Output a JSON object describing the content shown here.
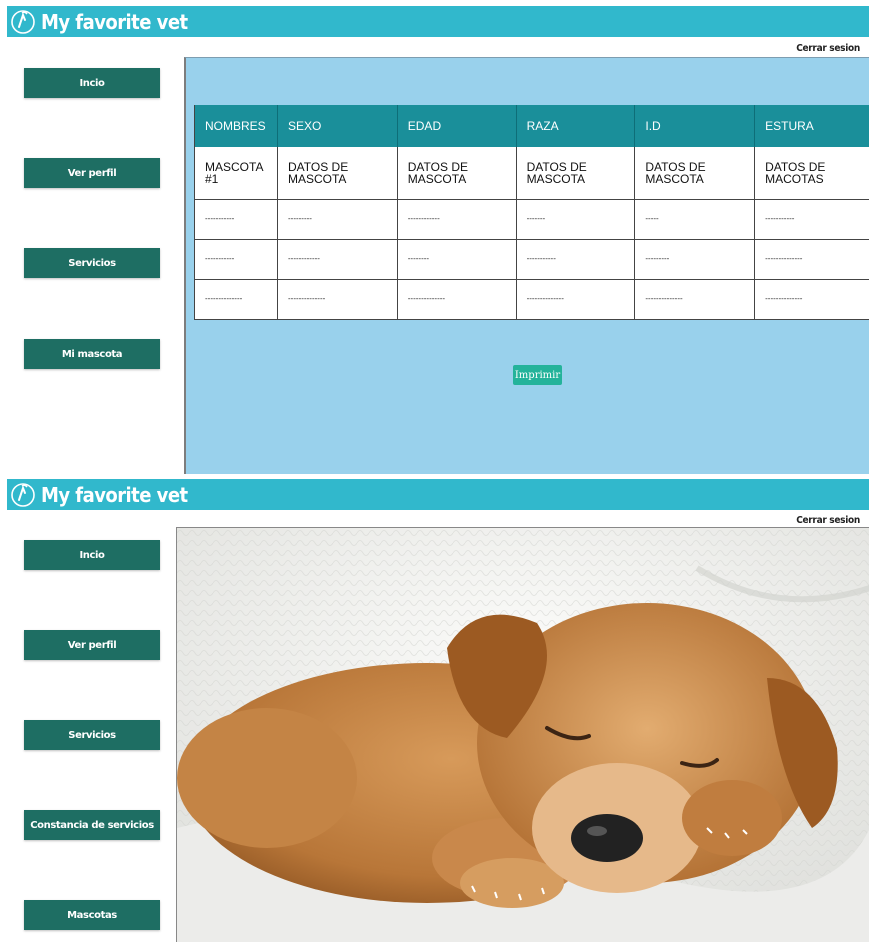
{
  "app": {
    "title": "My favorite vet",
    "logout": "Cerrar sesion",
    "colors": {
      "header": "#31b8cc",
      "nav_button": "#1e6e63",
      "content_bg": "#99d1ec",
      "table_header": "#1a8f9a",
      "print_button": "#24b39a"
    }
  },
  "top": {
    "nav": [
      "Incio",
      "Ver perfil",
      "Servicios",
      "Mi mascota"
    ],
    "table": {
      "headers": [
        "NOMBRES",
        "SEXO",
        "EDAD",
        "RAZA",
        "I.D",
        "ESTURA"
      ],
      "rows": [
        [
          "MASCOTA #1",
          "DATOS DE MASCOTA",
          "DATOS DE MASCOTA",
          "DATOS DE MASCOTA",
          "DATOS DE MASCOTA",
          "DATOS DE MACOTAS"
        ],
        [
          "-----------",
          "---------",
          "------------",
          "-------",
          "-----",
          "-----------"
        ],
        [
          "-----------",
          "------------",
          "--------",
          "-----------",
          "---------",
          "--------------"
        ],
        [
          "--------------",
          "--------------",
          "--------------",
          "--------------",
          "--------------",
          "--------------"
        ]
      ]
    },
    "print_label": "Imprimir"
  },
  "bottom": {
    "nav": [
      "Incio",
      "Ver perfil",
      "Servicios",
      "Constancia de servicios",
      "Mascotas"
    ],
    "image": "sleeping-puppy-photo"
  },
  "icons": {
    "logo": "vet-logo-icon"
  }
}
